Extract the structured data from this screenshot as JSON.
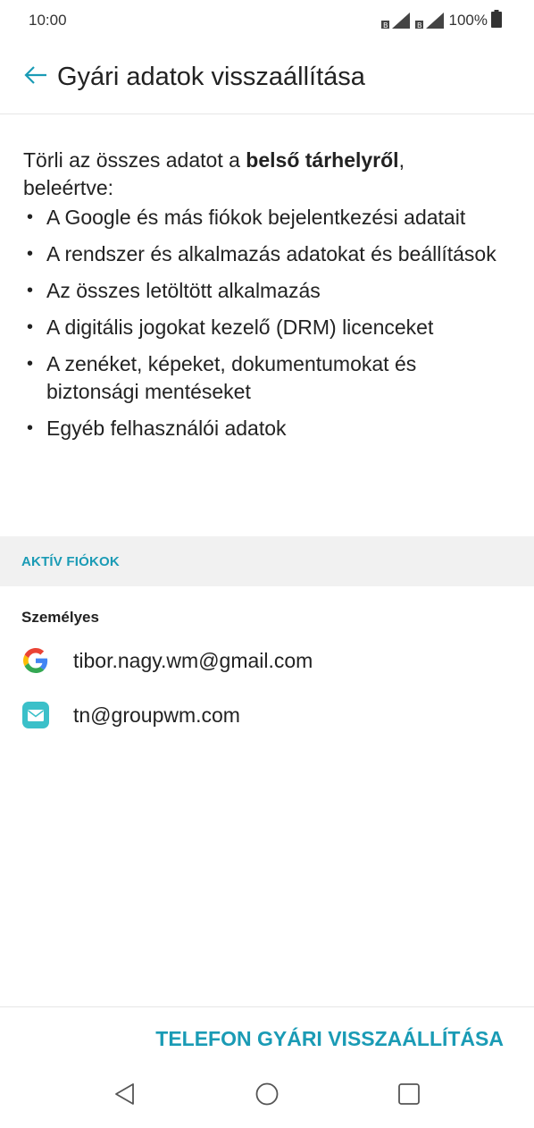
{
  "status_bar": {
    "time": "10:00",
    "battery": "100%"
  },
  "header": {
    "title": "Gyári adatok visszaállítása",
    "back_icon": "arrow-left-icon"
  },
  "intro": {
    "prefix": "Törli az összes adatot a ",
    "bold": "belső tárhelyről",
    "suffix": ", beleértve:"
  },
  "bullets": [
    "A Google és más fiókok bejelentkezési adatait",
    "A rendszer és alkalmazás adatokat és beállítások",
    "Az összes letöltött alkalmazás",
    "A digitális jogokat kezelő (DRM) licenceket",
    "A zenéket, képeket, dokumentumokat és biztonsági mentéseket",
    "Egyéb felhasználói adatok"
  ],
  "accounts_section": {
    "header": "AKTÍV FIÓKOK",
    "group_label": "Személyes",
    "accounts": [
      {
        "icon": "google-icon",
        "email": "tibor.nagy.wm@gmail.com"
      },
      {
        "icon": "email-app-icon",
        "email": "tn@groupwm.com"
      }
    ]
  },
  "action": {
    "label": "TELEFON GYÁRI VISSZAÁLLÍTÁSA"
  },
  "colors": {
    "accent": "#1a9bb5",
    "section_bg": "#f1f1f1",
    "email_icon": "#3bc0c9"
  }
}
